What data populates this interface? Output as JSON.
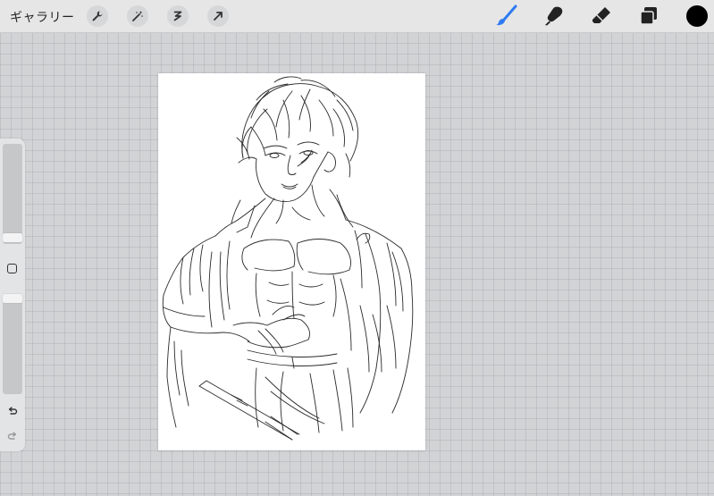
{
  "topbar": {
    "gallery_label": "ギャラリー",
    "tools_left": [
      "wrench-icon",
      "magic-wand-icon",
      "selection-icon",
      "transform-arrow-icon"
    ],
    "tools_right": [
      "brush-icon",
      "smudge-icon",
      "eraser-icon",
      "layers-icon"
    ],
    "active_tool": "brush-icon",
    "active_color": "#000000",
    "accent_color": "#2f7bf0"
  },
  "sidebar": {
    "brush_size_level": 0.0,
    "opacity_level": 0.0,
    "controls": [
      "modify-button",
      "undo-icon",
      "redo-icon"
    ]
  },
  "canvas": {
    "content": "pencil-sketch-figure"
  }
}
